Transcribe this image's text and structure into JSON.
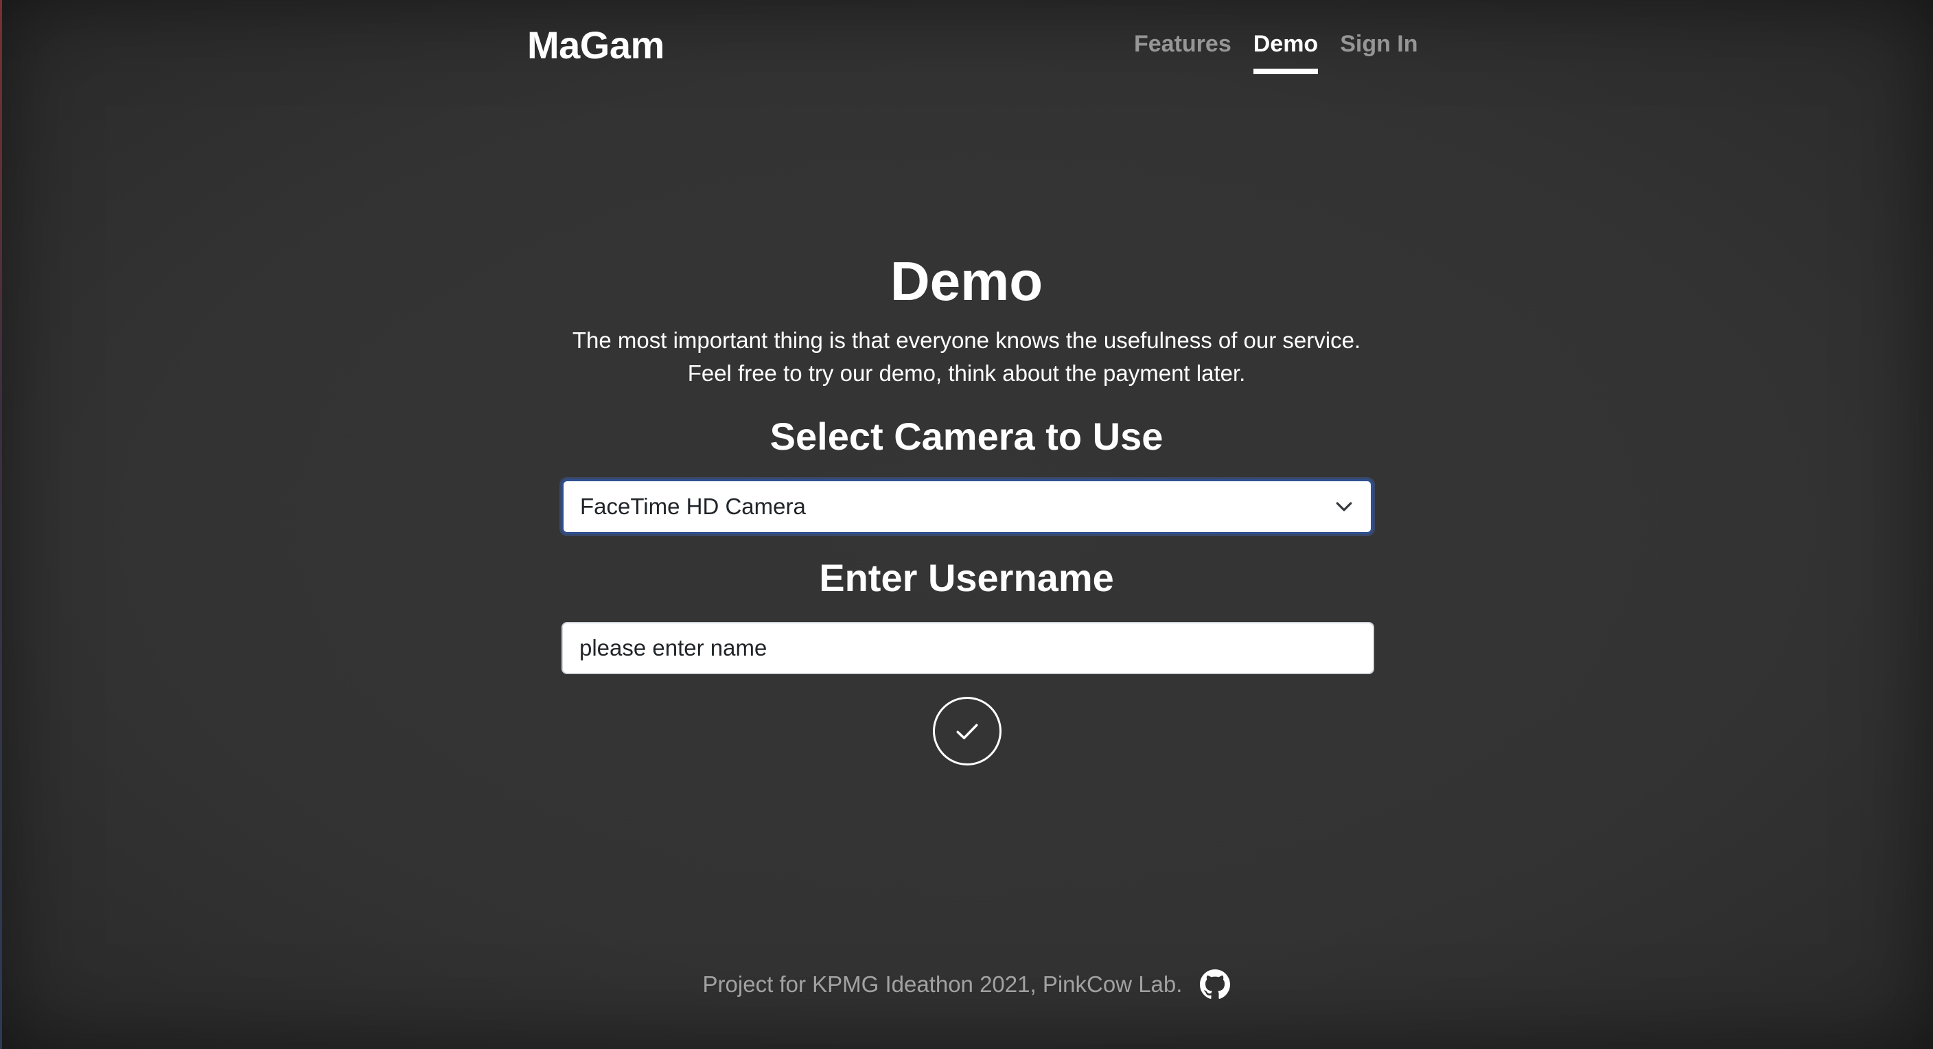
{
  "header": {
    "brand": "MaGam",
    "nav": [
      {
        "label": "Features",
        "active": false
      },
      {
        "label": "Demo",
        "active": true
      },
      {
        "label": "Sign In",
        "active": false
      }
    ]
  },
  "main": {
    "title": "Demo",
    "lead_line1": "The most important thing is that everyone knows the usefulness of our service.",
    "lead_line2": "Feel free to try our demo, think about the payment later.",
    "camera_heading": "Select Camera to Use",
    "camera_select": {
      "selected": "FaceTime HD Camera",
      "icon": "chevron-down-icon"
    },
    "username_heading": "Enter Username",
    "username_input": {
      "value": "",
      "placeholder": "please enter name"
    },
    "confirm_button": {
      "icon": "check-icon"
    }
  },
  "footer": {
    "text": "Project for KPMG Ideathon 2021, PinkCow Lab.",
    "icon": "github-icon"
  },
  "colors": {
    "background": "#333333",
    "text": "#ffffff",
    "nav_inactive": "rgba(255,255,255,0.5)",
    "select_focus_border": "#2f4f8f"
  }
}
